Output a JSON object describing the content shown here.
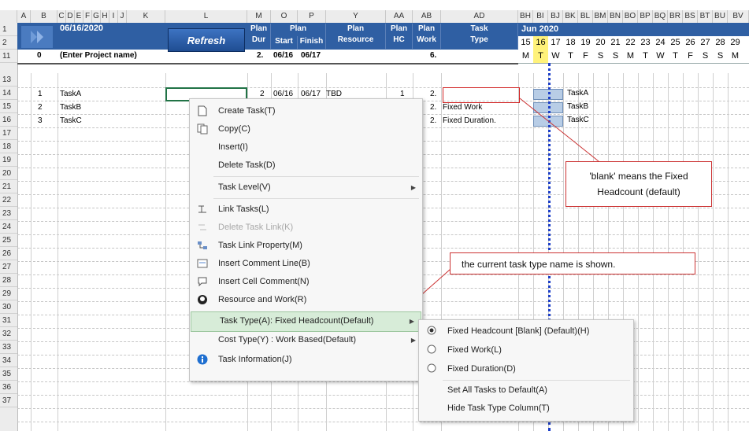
{
  "columns": [
    "A",
    "B",
    "C",
    "D",
    "E",
    "F",
    "G",
    "H",
    "I",
    "J",
    "K",
    "L",
    "M",
    "O",
    "P",
    "Y",
    "AA",
    "AB",
    "AD",
    "BH",
    "BI",
    "BJ",
    "BK",
    "BL",
    "BM",
    "BN",
    "BO",
    "BP",
    "BQ",
    "BR",
    "BS",
    "BT",
    "BU",
    "BV"
  ],
  "rows": [
    "1",
    "2",
    "11",
    "13",
    "14",
    "15",
    "16",
    "17",
    "18",
    "19",
    "20",
    "21",
    "22",
    "23",
    "24",
    "25",
    "26",
    "27",
    "28",
    "29",
    "30",
    "31",
    "32",
    "33",
    "34",
    "35",
    "36",
    "37"
  ],
  "header": {
    "date": "06/16/2020",
    "refresh_label": "Refresh",
    "plan_dur": [
      "Plan",
      "Dur"
    ],
    "plan_start_title": "Plan",
    "start": "Start",
    "finish": "Finish",
    "plan_resource": [
      "Plan",
      "Resource"
    ],
    "plan_hc": [
      "Plan",
      "HC"
    ],
    "plan_work": [
      "Plan",
      "Work"
    ],
    "task_type": [
      "Task",
      "Type"
    ],
    "month": "Jun 2020",
    "days": [
      "15",
      "16",
      "17",
      "18",
      "19",
      "20",
      "21",
      "22",
      "23",
      "24",
      "25",
      "26",
      "27",
      "28",
      "29"
    ],
    "weekdays": [
      "M",
      "T",
      "W",
      "T",
      "F",
      "S",
      "S",
      "M",
      "T",
      "W",
      "T",
      "F",
      "S",
      "S",
      "M"
    ]
  },
  "project_row": {
    "num": "0",
    "name": "(Enter Project name)",
    "dur": "2.",
    "start": "06/16",
    "finish": "06/17",
    "work": "6."
  },
  "tasks": [
    {
      "num": "1",
      "name": "TaskA",
      "dur": "2",
      "start": "06/16",
      "finish": "06/17",
      "resource": "TBD",
      "hc": "1",
      "work": "2.",
      "type": "",
      "bar_label": "TaskA"
    },
    {
      "num": "2",
      "name": "TaskB",
      "dur": "",
      "start": "",
      "finish": "",
      "resource": "",
      "hc": "",
      "work": "2.",
      "type": "Fixed Work",
      "bar_label": "TaskB"
    },
    {
      "num": "3",
      "name": "TaskC",
      "dur": "",
      "start": "",
      "finish": "",
      "resource": "",
      "hc": "",
      "work": "2.",
      "type": "Fixed Duration.",
      "bar_label": "TaskC"
    }
  ],
  "context_menu": [
    {
      "label": "Create Task(T)",
      "icon": "page-icon"
    },
    {
      "label": "Copy(C)",
      "icon": "copy-icon"
    },
    {
      "label": "Insert(I)",
      "icon": ""
    },
    {
      "label": "Delete Task(D)",
      "icon": ""
    },
    {
      "label": "Task Level(V)",
      "icon": ""
    },
    {
      "label": "Link Tasks(L)",
      "icon": "link-icon"
    },
    {
      "label": "Delete Task Link(K)",
      "icon": "unlink-icon"
    },
    {
      "label": "Task Link Property(M)",
      "icon": "link-property-icon"
    },
    {
      "label": "Insert Comment Line(B)",
      "icon": "comment-line-icon"
    },
    {
      "label": "Insert Cell Comment(N)",
      "icon": "cell-comment-icon"
    },
    {
      "label": "Resource and Work(R)",
      "icon": "resource-icon"
    },
    {
      "label": "Task Type(A): Fixed Headcount(Default)",
      "icon": ""
    },
    {
      "label": "Cost Type(Y) : Work Based(Default)",
      "icon": ""
    },
    {
      "label": "Task Information(J)",
      "icon": "info-icon"
    }
  ],
  "submenu": [
    {
      "label": "Fixed Headcount [Blank] (Default)(H)",
      "selected": true
    },
    {
      "label": "Fixed Work(L)",
      "selected": false
    },
    {
      "label": "Fixed Duration(D)",
      "selected": false
    },
    {
      "label": "Set All Tasks to Default(A)",
      "selected": false
    },
    {
      "label": "Hide Task Type Column(T)",
      "selected": false
    }
  ],
  "callouts": {
    "blank": [
      "'blank' means the Fixed",
      "Headcount (default)"
    ],
    "current": "the current task type name is shown."
  },
  "colors": {
    "header_blue": "#2f5fa3",
    "callout_red": "#cc3333",
    "bar": "#b8cde6",
    "today": "#fff27a"
  }
}
